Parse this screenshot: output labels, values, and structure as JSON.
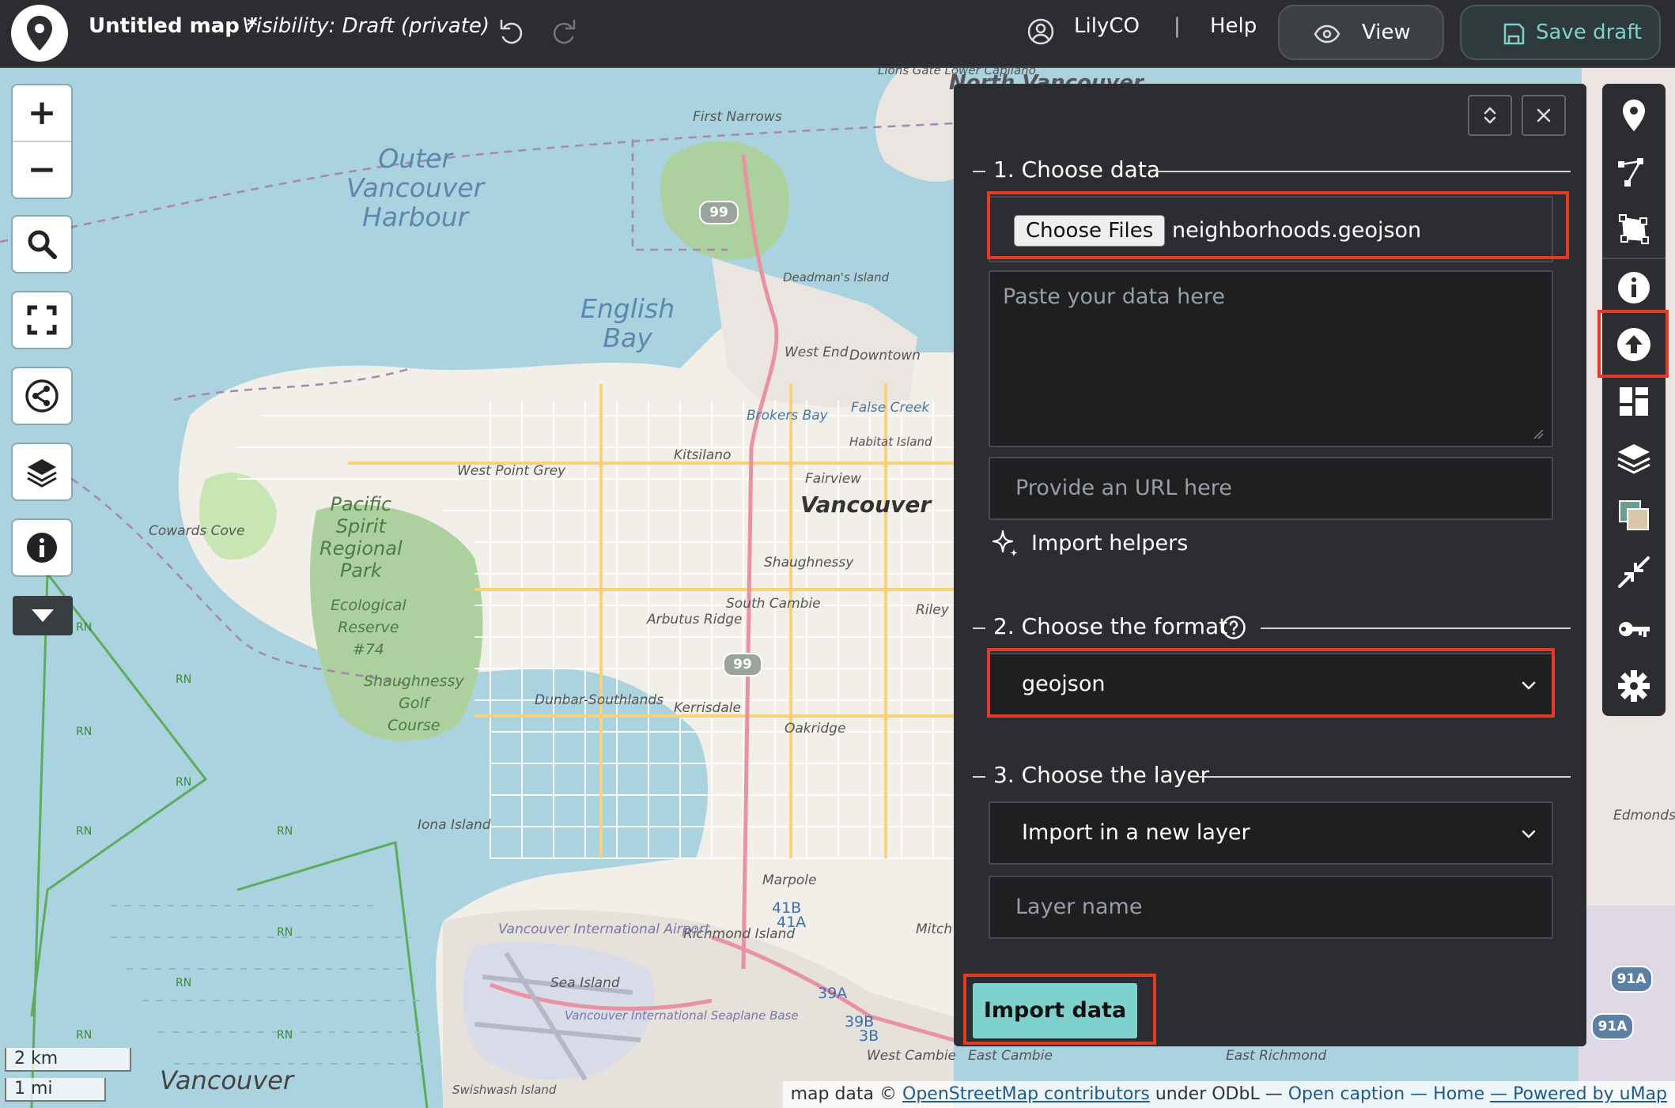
{
  "app": {
    "map_title": "Untitled map *",
    "visibility": "Visibility: Draft (private)",
    "user_name": "LilyCO",
    "separator": "|",
    "help": "Help",
    "view_label": "View",
    "save_label": "Save draft"
  },
  "colors": {
    "topbar_bg": "#2b2d30",
    "save_accent": "#7fd1cd",
    "import_button": "#7fd1cd",
    "highlight": "#e53a25"
  },
  "map": {
    "water_labels": [
      "Outer Vancouver Harbour",
      "English Bay"
    ],
    "park_labels": [
      "Pacific Spirit Regional Park",
      "Ecological Reserve #74",
      "Shaughnessy Golf Course"
    ],
    "city_label": "Vancouver",
    "place_labels": {
      "first_narrows": "First Narrows",
      "deadmans_island": "Deadman's Island",
      "west_end": "West End",
      "downtown": "Downtown",
      "false_creek": "False Creek",
      "brokers_bay": "Brokers Bay",
      "kitsilano": "Kitsilano",
      "habitat_island": "Habitat Island",
      "fairview": "Fairview",
      "west_point_grey": "West Point Grey",
      "cowards_cove": "Cowards Cove",
      "shaughnessy": "Shaughnessy",
      "arbutus_ridge": "Arbutus Ridge",
      "south_cambie": "South Cambie",
      "riley": "Riley",
      "dunbar": "Dunbar-Southlands",
      "kerrisdale": "Kerrisdale",
      "oakridge": "Oakridge",
      "iona_island": "Iona Island",
      "marpole": "Marpole",
      "richmond_island": "Richmond Island",
      "mitchell_island": "Mitch Islan",
      "airport": "Vancouver International Airport",
      "sea_island": "Sea Island",
      "seaplane": "Vancouver International Seaplane Base",
      "swishwash": "Swishwash Island",
      "west_cambie": "West Cambie",
      "east_cambie": "East Cambie",
      "east_richmond": "East Richmond",
      "edmonds": "Edmonds",
      "north_vancouver": "North Vancouver",
      "lions_gate": "Lions Gate Lower Capilano",
      "bottom_vancouver": "Vancouver"
    },
    "highway_labels": [
      "99",
      "99",
      "41B",
      "41A",
      "39A",
      "39B",
      "3B",
      "91A",
      "91A"
    ],
    "rn_label": "RN",
    "scale_km": "2 km",
    "scale_mi": "1 mi"
  },
  "attribution": {
    "prefix": "map data ©",
    "osm": "OpenStreetMap contributors",
    "license": "under ODbL —",
    "open_caption": "Open caption",
    "home": "— Home",
    "powered": "— Powered by uMap"
  },
  "left_controls": [
    {
      "name": "zoom-in",
      "glyph": "+"
    },
    {
      "name": "zoom-out",
      "glyph": "−"
    },
    {
      "name": "search-icon"
    },
    {
      "name": "fullscreen-icon"
    },
    {
      "name": "share-icon"
    },
    {
      "name": "layers-icon"
    },
    {
      "name": "info-icon"
    },
    {
      "name": "more-icon"
    }
  ],
  "right_toolbar": [
    "marker-icon",
    "line-icon",
    "polygon-icon",
    "info-icon",
    "upload-icon",
    "layout-icon",
    "layers-icon",
    "map-background-icon",
    "fit-icon",
    "key-icon",
    "gear-icon"
  ],
  "import_panel": {
    "section1": "1. Choose data",
    "choose_files": "Choose Files",
    "file_name": "neighborhoods.geojson",
    "paste_placeholder": "Paste your data here",
    "url_placeholder": "Provide an URL here",
    "import_helpers": "Import helpers",
    "section2": "2. Choose the format",
    "format_value": "geojson",
    "format_options": [
      "geojson"
    ],
    "section3": "3. Choose the layer",
    "layer_value": "Import in a new layer",
    "layer_name_placeholder": "Layer name",
    "import_button": "Import data"
  }
}
